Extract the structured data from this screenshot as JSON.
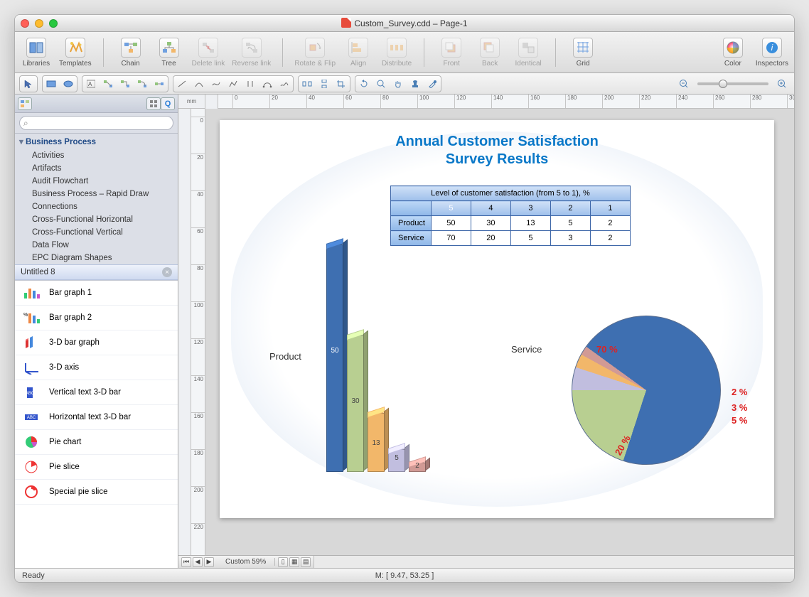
{
  "window": {
    "title": "Custom_Survey.cdd – Page-1"
  },
  "toolbar": {
    "items": [
      {
        "id": "libraries",
        "label": "Libraries"
      },
      {
        "id": "templates",
        "label": "Templates"
      },
      {
        "id": "chain",
        "label": "Chain"
      },
      {
        "id": "tree",
        "label": "Tree"
      },
      {
        "id": "delete-link",
        "label": "Delete link",
        "dim": true
      },
      {
        "id": "reverse-link",
        "label": "Reverse link",
        "dim": true
      },
      {
        "id": "rotate-flip",
        "label": "Rotate & Flip",
        "dim": true
      },
      {
        "id": "align",
        "label": "Align",
        "dim": true
      },
      {
        "id": "distribute",
        "label": "Distribute",
        "dim": true
      },
      {
        "id": "front",
        "label": "Front",
        "dim": true
      },
      {
        "id": "back",
        "label": "Back",
        "dim": true
      },
      {
        "id": "identical",
        "label": "Identical",
        "dim": true
      },
      {
        "id": "grid",
        "label": "Grid"
      },
      {
        "id": "color",
        "label": "Color"
      },
      {
        "id": "inspectors",
        "label": "Inspectors"
      }
    ]
  },
  "sidebar": {
    "tree_header": "Business Process",
    "tree_items": [
      "Activities",
      "Artifacts",
      "Audit Flowchart",
      "Business Process – Rapid Draw",
      "Connections",
      "Cross-Functional Horizontal",
      "Cross-Functional Vertical",
      "Data Flow",
      "EPC Diagram Shapes"
    ],
    "lib_header": "Untitled 8",
    "palette": [
      "Bar graph   1",
      "Bar graph   2",
      "3-D bar graph",
      "3-D axis",
      "Vertical text 3-D bar",
      "Horizontal text 3-D bar",
      "Pie chart",
      "Pie slice",
      "Special pie slice"
    ],
    "search_placeholder": ""
  },
  "ruler": {
    "unit": "mm"
  },
  "hscroll": {
    "page_label": "Custom 59%"
  },
  "status": {
    "left": "Ready",
    "mid": "M: [ 9.47, 53.25 ]"
  },
  "chart_data": {
    "title": "Annual Customer Satisfaction\nSurvey Results",
    "table": {
      "caption": "Level of customer satisfaction (from 5 to 1), %",
      "columns": [
        "5",
        "4",
        "3",
        "2",
        "1"
      ],
      "rows": [
        {
          "label": "Product",
          "values": [
            50,
            30,
            13,
            5,
            2
          ]
        },
        {
          "label": "Service",
          "values": [
            70,
            20,
            5,
            3,
            2
          ]
        }
      ]
    },
    "bar": {
      "type": "bar",
      "label": "Product",
      "categories": [
        "5",
        "4",
        "3",
        "2",
        "1"
      ],
      "values": [
        50,
        30,
        13,
        5,
        2
      ],
      "colors": [
        "#3e6fb1",
        "#b8cf91",
        "#f2b76a",
        "#c1bedf",
        "#d19a95"
      ]
    },
    "pie": {
      "type": "pie",
      "label": "Service",
      "slices": [
        {
          "label": "70 %",
          "value": 70,
          "color": "#3e6fb1"
        },
        {
          "label": "20 %",
          "value": 20,
          "color": "#b8cf91"
        },
        {
          "label": "5 %",
          "value": 5,
          "color": "#c1bedf"
        },
        {
          "label": "3 %",
          "value": 3,
          "color": "#f2b76a"
        },
        {
          "label": "2 %",
          "value": 2,
          "color": "#d19a95"
        }
      ]
    }
  }
}
